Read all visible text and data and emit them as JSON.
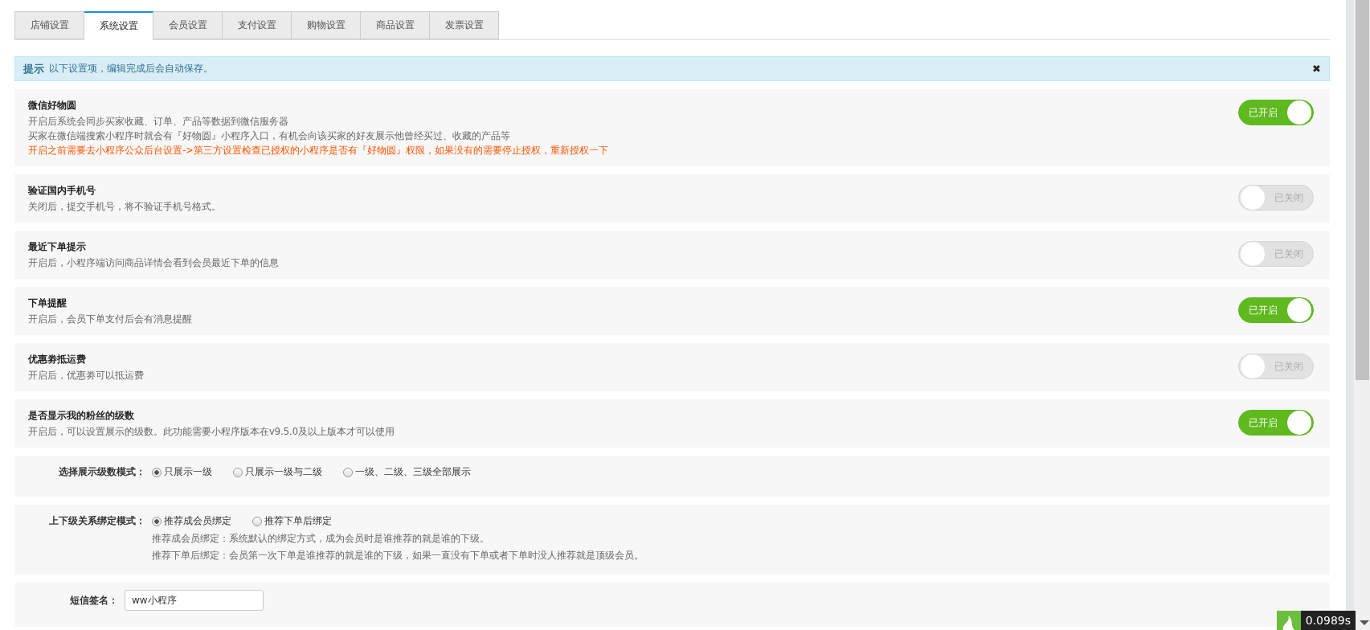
{
  "tabs": [
    {
      "label": "店铺设置",
      "selected": false
    },
    {
      "label": "系统设置",
      "selected": true
    },
    {
      "label": "会员设置",
      "selected": false
    },
    {
      "label": "支付设置",
      "selected": false
    },
    {
      "label": "购物设置",
      "selected": false
    },
    {
      "label": "商品设置",
      "selected": false
    },
    {
      "label": "发票设置",
      "selected": false
    }
  ],
  "notice": {
    "title": "提示",
    "text": "以下设置项，编辑完成后会自动保存。",
    "close": "✖"
  },
  "settings": [
    {
      "kind": "toggle",
      "title": "微信好物圆",
      "lines": [
        {
          "kind": "note",
          "text": "开启后系统会同步买家收藏、订单、产品等数据到微信服务器"
        },
        {
          "kind": "note",
          "text": "买家在微信端搜索小程序时就会有『好物圆』小程序入口，有机会向该买家的好友展示他曾经买过、收藏的产品等"
        },
        {
          "kind": "warning",
          "text": "开启之前需要去小程序公众后台设置->第三方设置检查已授权的小程序是否有『好物圆』权限，如果没有的需要停止授权，重新授权一下"
        }
      ],
      "on": true,
      "state_label": "已开启"
    },
    {
      "kind": "toggle",
      "title": "验证国内手机号",
      "lines": [
        {
          "kind": "note",
          "text": "关闭后，提交手机号，将不验证手机号格式。"
        }
      ],
      "on": false,
      "state_label": "已关闭"
    },
    {
      "kind": "toggle",
      "title": "最近下单提示",
      "lines": [
        {
          "kind": "note",
          "text": "开启后，小程序端访问商品详情会看到会员最近下单的信息"
        }
      ],
      "on": false,
      "state_label": "已关闭"
    },
    {
      "kind": "toggle",
      "title": "下单提醒",
      "lines": [
        {
          "kind": "note",
          "text": "开启后，会员下单支付后会有消息提醒"
        }
      ],
      "on": true,
      "state_label": "已开启"
    },
    {
      "kind": "toggle",
      "title": "优惠劵抵运费",
      "lines": [
        {
          "kind": "note",
          "text": "开启后，优惠劵可以抵运费"
        }
      ],
      "on": false,
      "state_label": "已关闭"
    },
    {
      "kind": "toggle",
      "title": "是否显示我的粉丝的级数",
      "lines": [
        {
          "kind": "note",
          "text": "开启后，可以设置展示的级数。此功能需要小程序版本在v9.5.0及以上版本才可以使用"
        }
      ],
      "on": true,
      "state_label": "已开启"
    },
    {
      "kind": "radio",
      "label": "选择展示级数模式：",
      "options": [
        {
          "label": "只展示一级",
          "selected": true
        },
        {
          "label": "只展示一级与二级",
          "selected": false
        },
        {
          "label": "一级、二级、三级全部展示",
          "selected": false
        }
      ]
    },
    {
      "kind": "radio",
      "label": "上下级关系绑定模式：",
      "options": [
        {
          "label": "推荐成会员绑定",
          "selected": true
        },
        {
          "label": "推荐下单后绑定",
          "selected": false
        }
      ],
      "notes": [
        "推荐成会员绑定：系统默认的绑定方式，成为会员时是谁推荐的就是谁的下级。",
        "推荐下单后绑定：会员第一次下单是谁推荐的就是谁的下级，如果一直没有下单或者下单时没人推荐就是顶级会员。"
      ]
    },
    {
      "kind": "input",
      "label": "短信签名：",
      "value": "ww小程序"
    }
  ],
  "debug_bar": {
    "time": "0.0989s"
  }
}
